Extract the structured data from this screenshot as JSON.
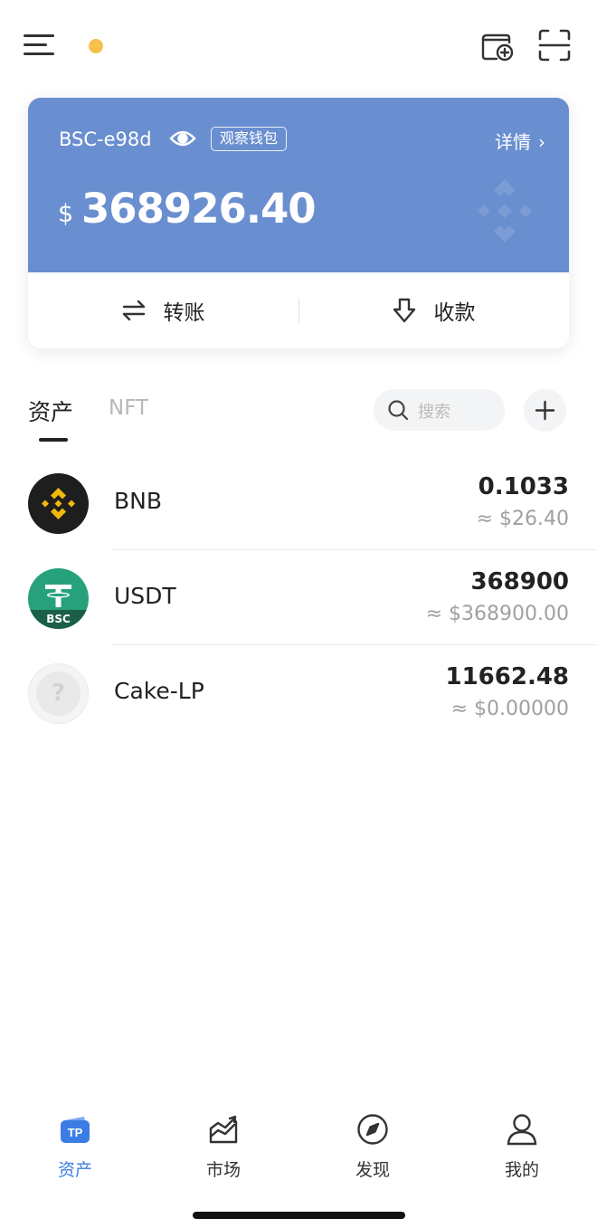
{
  "topbar": {
    "menu_icon": "menu-icon",
    "status_dot_color": "#f7c04a",
    "wallet_add_icon": "wallet-add-icon",
    "scan_icon": "scan-icon"
  },
  "wallet_card": {
    "name": "BSC-e98d",
    "watch_badge": "观察钱包",
    "details_label": "详情",
    "currency_symbol": "$",
    "balance": "368926.40",
    "card_color": "#6a8fd0",
    "transfer_label": "转账",
    "receive_label": "收款"
  },
  "tabs": {
    "assets": "资产",
    "nft": "NFT",
    "search_placeholder": "搜索"
  },
  "assets": [
    {
      "symbol": "BNB",
      "amount": "0.1033",
      "value": "≈ $26.40",
      "icon": "bnb-icon"
    },
    {
      "symbol": "USDT",
      "amount": "368900",
      "value": "≈ $368900.00",
      "icon": "usdt-bsc-icon",
      "badge": "BSC"
    },
    {
      "symbol": "Cake-LP",
      "amount": "11662.48",
      "value": "≈ $0.00000",
      "icon": "unknown-token-icon",
      "placeholder_glyph": "?"
    }
  ],
  "bottom_nav": [
    {
      "label": "资产",
      "icon": "tp-wallet-icon",
      "active": true,
      "logo_text": "TP"
    },
    {
      "label": "市场",
      "icon": "market-chart-icon",
      "active": false
    },
    {
      "label": "发现",
      "icon": "compass-icon",
      "active": false
    },
    {
      "label": "我的",
      "icon": "profile-icon",
      "active": false
    }
  ],
  "colors": {
    "accent": "#3b7de5",
    "bnb_yellow": "#f0b90b",
    "usdt_green": "#26a17b"
  }
}
